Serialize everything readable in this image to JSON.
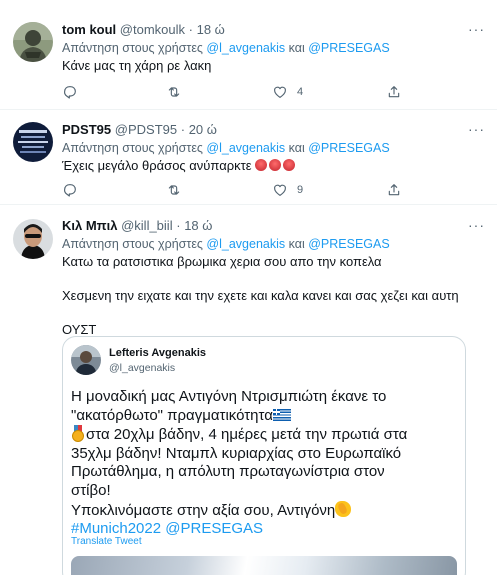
{
  "tweets": [
    {
      "name": "tom koul",
      "handle": "@tomkoulk",
      "dot": "·",
      "time": "18 ώ",
      "reply_prefix": "Απάντηση στους χρήστες",
      "mention1": "@l_avgenakis",
      "reply_and": "και",
      "mention2": "@PRESEGAS",
      "text": "Κάνε μας τη χάρη ρε λακη",
      "likes": "4",
      "more": "···"
    },
    {
      "name": "PDST95",
      "handle": "@PDST95",
      "dot": "·",
      "time": "20 ώ",
      "reply_prefix": "Απάντηση στους χρήστες",
      "mention1": "@l_avgenakis",
      "reply_and": "και",
      "mention2": "@PRESEGAS",
      "text": "Έχεις μεγάλο θράσος ανύπαρκτε",
      "likes": "9",
      "more": "···"
    },
    {
      "name": "Κιλ Μπιλ",
      "handle": "@kill_biil",
      "dot": "·",
      "time": "18 ώ",
      "reply_prefix": "Απάντηση στους χρήστες",
      "mention1": "@l_avgenakis",
      "reply_and": "και",
      "mention2": "@PRESEGAS",
      "text_line1": "Κατω τα ρατσιστικα βρωμικα χερια σου απο την κοπελα",
      "text_line2": "Χεσμενη την ειχατε και την εχετε και καλα κανει και σας χεζει και αυτη",
      "text_line3": "ΟΥΣΤ",
      "more": "···"
    }
  ],
  "quote": {
    "name": "Lefteris Avgenakis",
    "handle": "@l_avgenakis",
    "line1": "Η μοναδική μας Αντιγόνη Ντρισμπιώτη έκανε το",
    "line2": "\"ακατόρθωτο\" πραγματικότητα",
    "line3": "στα 20χλμ βάδην, 4 ημέρες μετά την πρωτιά στα",
    "line4": "35χλμ βάδην! Νταμπλ κυριαρχίας στο Ευρωπαϊκό",
    "line5": "Πρωτάθλημα, η απόλυτη πρωταγωνίστρια στον",
    "line6": "στίβο!",
    "line7": "Υποκλινόμαστε στην αξία σου, Αντιγόνη",
    "hashtag": "#Munich2022",
    "mention": "@PRESEGAS",
    "translate": "Translate Tweet"
  },
  "colors": {
    "link": "#1d9bf0",
    "secondary_text": "#536471",
    "divider": "#eff3f4"
  },
  "icons": [
    "reply-icon",
    "retweet-icon",
    "like-icon",
    "share-icon",
    "more-icon"
  ]
}
